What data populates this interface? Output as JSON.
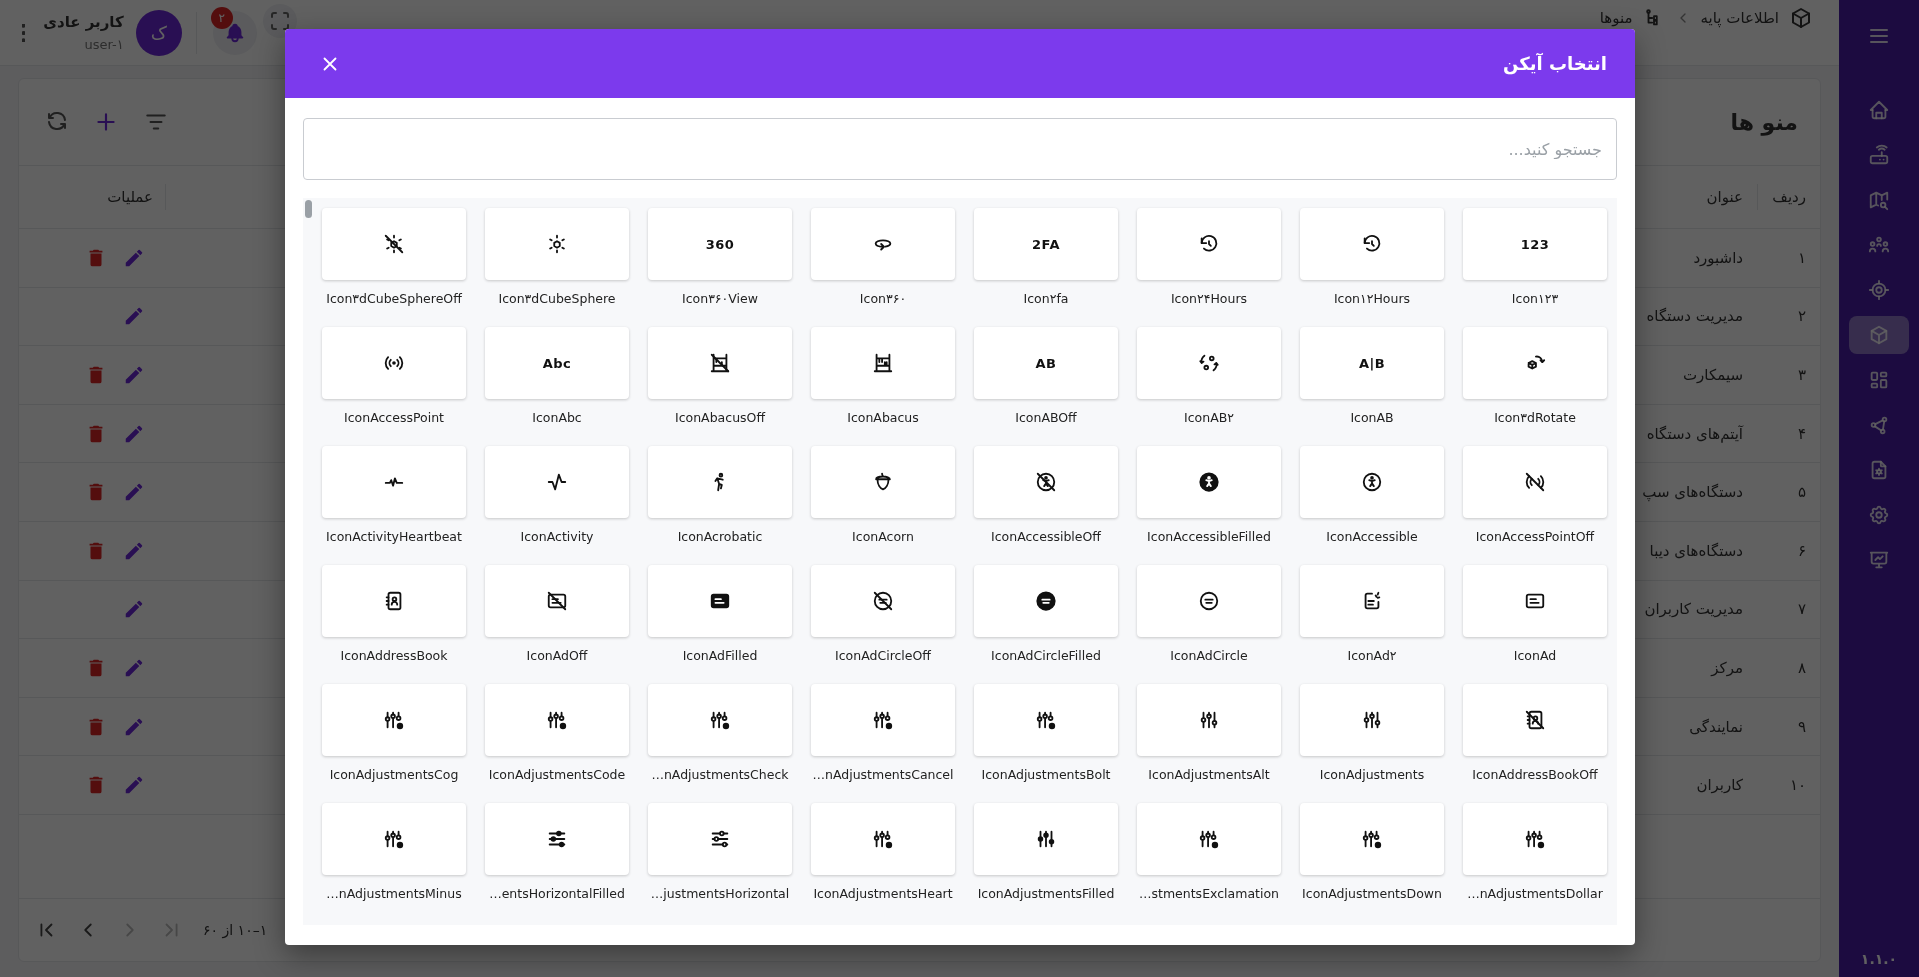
{
  "sidebar": {
    "items": [
      {
        "selected": false
      },
      {
        "selected": false
      },
      {
        "selected": false
      },
      {
        "selected": false
      },
      {
        "selected": false
      },
      {
        "selected": true
      },
      {
        "selected": false
      },
      {
        "selected": false
      },
      {
        "selected": false
      },
      {
        "selected": false
      },
      {
        "selected": false
      }
    ],
    "version": "۱.۱.۰"
  },
  "header": {
    "breadcrumb": [
      "اطلاعات پایه",
      "منوها"
    ],
    "notifications": "۲",
    "user": {
      "name": "کاربر عادی",
      "id": "user-۱",
      "initial": "ک"
    }
  },
  "page": {
    "title": "منو ها",
    "table": {
      "columns": [
        "ردیف",
        "عنوان",
        "عملیات"
      ],
      "rows": [
        {
          "cells": [
            "۱",
            "داشبورد"
          ],
          "deletable": true
        },
        {
          "cells": [
            "۲",
            "مدیریت دستگاه"
          ],
          "deletable": false
        },
        {
          "cells": [
            "۳",
            "سیمکارت"
          ],
          "deletable": true
        },
        {
          "cells": [
            "۴",
            "آیتم‌های دستگاه"
          ],
          "deletable": true
        },
        {
          "cells": [
            "۵",
            "دستگاه‌های سپ"
          ],
          "deletable": true
        },
        {
          "cells": [
            "۶",
            "دستگاه‌های دیبا"
          ],
          "deletable": true
        },
        {
          "cells": [
            "۷",
            "مدیریت کاربران"
          ],
          "deletable": false
        },
        {
          "cells": [
            "۸",
            "مرکز"
          ],
          "deletable": true
        },
        {
          "cells": [
            "۹",
            "نمایندگی"
          ],
          "deletable": true
        },
        {
          "cells": [
            "۱۰",
            "کاربران"
          ],
          "deletable": true
        }
      ]
    },
    "pagination": {
      "range": "۱–۱۰ از ۶۰",
      "buttons": [
        {
          "kind": "last",
          "disabled": true
        },
        {
          "kind": "next",
          "disabled": true
        },
        {
          "kind": "prev",
          "disabled": false
        },
        {
          "kind": "first",
          "disabled": false
        }
      ]
    }
  },
  "dialog": {
    "title": "انتخاب آیکن",
    "search": {
      "placeholder": "جستجو کنید..."
    },
    "icons": [
      {
        "label": "Icon۱۲۳",
        "glyph": "123"
      },
      {
        "label": "Icon۱۲Hours"
      },
      {
        "label": "Icon۲۴Hours"
      },
      {
        "label": "Icon۲fa",
        "glyph": "2FA"
      },
      {
        "label": "Icon۳۶۰"
      },
      {
        "label": "Icon۳۶۰View",
        "glyph": "360"
      },
      {
        "label": "Icon۳dCubeSphere"
      },
      {
        "label": "Icon۳dCubeSphereOff"
      },
      {
        "label": "Icon۳dRotate"
      },
      {
        "label": "IconAB",
        "glyph": "A|B"
      },
      {
        "label": "IconAB۲"
      },
      {
        "label": "IconABOff",
        "glyph": "AB"
      },
      {
        "label": "IconAbacus"
      },
      {
        "label": "IconAbacusOff"
      },
      {
        "label": "IconAbc",
        "glyph": "Abc"
      },
      {
        "label": "IconAccessPoint"
      },
      {
        "label": "IconAccessPointOff"
      },
      {
        "label": "IconAccessible"
      },
      {
        "label": "IconAccessibleFilled"
      },
      {
        "label": "IconAccessibleOff"
      },
      {
        "label": "IconAcorn"
      },
      {
        "label": "IconAcrobatic"
      },
      {
        "label": "IconActivity"
      },
      {
        "label": "IconActivityHeartbeat"
      },
      {
        "label": "IconAd"
      },
      {
        "label": "IconAd۲"
      },
      {
        "label": "IconAdCircle"
      },
      {
        "label": "IconAdCircleFilled"
      },
      {
        "label": "IconAdCircleOff"
      },
      {
        "label": "IconAdFilled"
      },
      {
        "label": "IconAdOff"
      },
      {
        "label": "IconAddressBook"
      },
      {
        "label": "IconAddressBookOff"
      },
      {
        "label": "IconAdjustments"
      },
      {
        "label": "IconAdjustmentsAlt"
      },
      {
        "label": "IconAdjustmentsBolt"
      },
      {
        "label": "…nAdjustmentsCancel"
      },
      {
        "label": "…nAdjustmentsCheck"
      },
      {
        "label": "IconAdjustmentsCode"
      },
      {
        "label": "IconAdjustmentsCog"
      },
      {
        "label": "…nAdjustmentsDollar"
      },
      {
        "label": "IconAdjustmentsDown"
      },
      {
        "label": "…stmentsExclamation"
      },
      {
        "label": "IconAdjustmentsFilled"
      },
      {
        "label": "IconAdjustmentsHeart"
      },
      {
        "label": "…justmentsHorizontal"
      },
      {
        "label": "…entsHorizontalFilled"
      },
      {
        "label": "…nAdjustmentsMinus"
      }
    ]
  }
}
